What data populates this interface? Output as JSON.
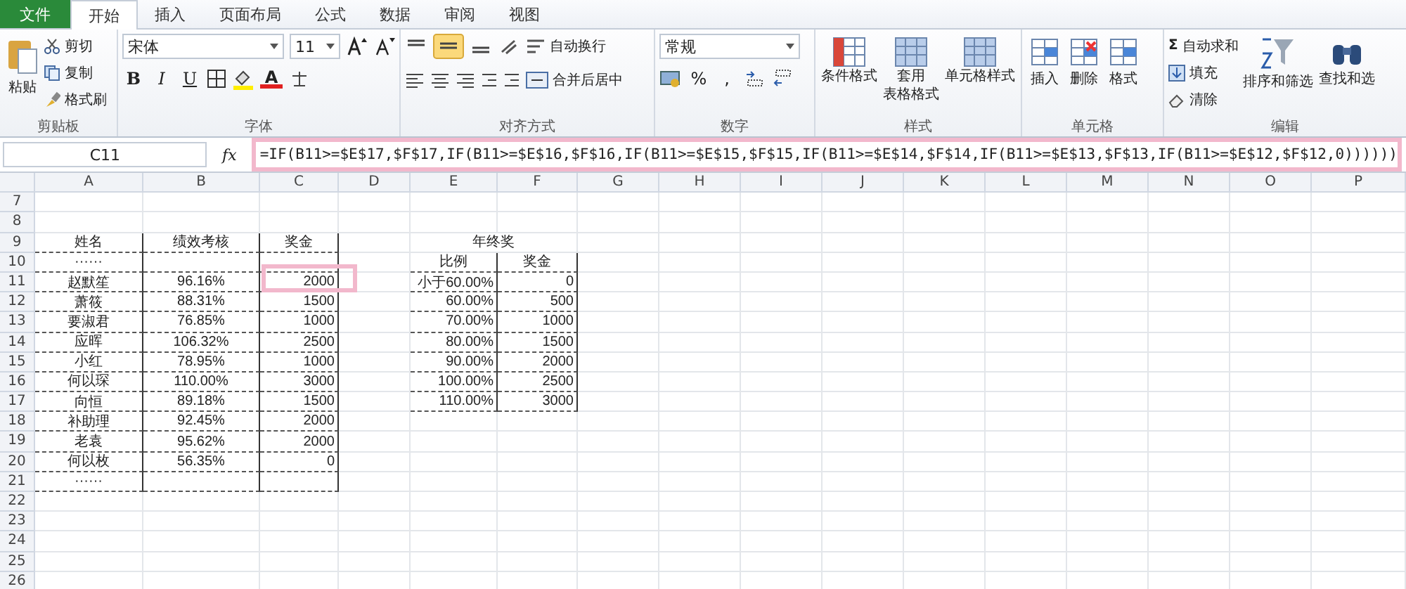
{
  "ribbon_tabs": [
    {
      "label": "文件",
      "kind": "file",
      "selected": false
    },
    {
      "label": "开始",
      "kind": "tab",
      "selected": true
    },
    {
      "label": "插入",
      "kind": "tab",
      "selected": false
    },
    {
      "label": "页面布局",
      "kind": "tab",
      "selected": false
    },
    {
      "label": "公式",
      "kind": "tab",
      "selected": false
    },
    {
      "label": "数据",
      "kind": "tab",
      "selected": false
    },
    {
      "label": "审阅",
      "kind": "tab",
      "selected": false
    },
    {
      "label": "视图",
      "kind": "tab",
      "selected": false
    }
  ],
  "ribbon": {
    "clipboard": {
      "label": "剪贴板",
      "paste": "粘贴",
      "cut": "剪切",
      "copy": "复制",
      "format_painter": "格式刷"
    },
    "font": {
      "label": "字体",
      "font_name": "宋体",
      "font_size": "11",
      "bold": "B",
      "italic": "I",
      "underline": "U",
      "font_color": "A"
    },
    "alignment": {
      "label": "对齐方式",
      "wrap_text": "自动换行",
      "merge_center": "合并后居中"
    },
    "number": {
      "label": "数字",
      "format": "常规",
      "percent": "%",
      "comma": ","
    },
    "styles": {
      "label": "样式",
      "buttons": [
        {
          "lines": [
            "条件格式"
          ]
        },
        {
          "lines": [
            "套用",
            "表格格式"
          ]
        },
        {
          "lines": [
            "单元格样式"
          ]
        }
      ]
    },
    "cells": {
      "label": "单元格",
      "buttons": [
        "插入",
        "删除",
        "格式"
      ]
    },
    "editing": {
      "label": "编辑",
      "sigma": "Σ",
      "autosum": "自动求和",
      "fill": "填充",
      "clear": "清除",
      "sort_filter": "排序和筛选",
      "find_select": "查找和选"
    }
  },
  "name_box": "C11",
  "fx": "fx",
  "formula": "=IF(B11>=$E$17,$F$17,IF(B11>=$E$16,$F$16,IF(B11>=$E$15,$F$15,IF(B11>=$E$14,$F$14,IF(B11>=$E$13,$F$13,IF(B11>=$E$12,$F$12,0))))))",
  "columns": [
    "A",
    "B",
    "C",
    "D",
    "E",
    "F",
    "G",
    "H",
    "I",
    "J",
    "K",
    "L",
    "M",
    "N",
    "O",
    "P"
  ],
  "rows": [
    {
      "number": "7",
      "cells": []
    },
    {
      "number": "8",
      "cells": []
    },
    {
      "number": "9",
      "cells": [
        {
          "text": "姓名",
          "boxed": true,
          "kind": "centered"
        },
        {
          "text": "绩效考核",
          "boxed": true,
          "kind": "centered"
        },
        {
          "text": "奖金",
          "boxed": true,
          "kind": "centered"
        },
        null,
        {
          "text": "年终奖",
          "merged": true,
          "kind": "centered"
        }
      ]
    },
    {
      "number": "10",
      "cells": [
        {
          "text": "······",
          "boxed": true,
          "kind": "centered"
        },
        {
          "boxed": true
        },
        {
          "boxed": true
        },
        null,
        {
          "text": "比例",
          "boxed": true,
          "kind": "centered"
        },
        {
          "text": "奖金",
          "boxed": true,
          "kind": "centered"
        }
      ]
    },
    {
      "number": "11",
      "cells": [
        {
          "text": "赵默笙",
          "boxed": true,
          "kind": "centered"
        },
        {
          "text": "96.16%",
          "boxed": true,
          "kind": "centered"
        },
        {
          "text": "2000",
          "boxed": true,
          "kind": "numeric"
        },
        null,
        {
          "text": "小于60.00%",
          "boxed": true,
          "kind": "numeric"
        },
        {
          "text": "0",
          "boxed": true,
          "kind": "numeric"
        }
      ]
    },
    {
      "number": "12",
      "cells": [
        {
          "text": "萧筱",
          "boxed": true,
          "kind": "centered"
        },
        {
          "text": "88.31%",
          "boxed": true,
          "kind": "centered"
        },
        {
          "text": "1500",
          "boxed": true,
          "kind": "numeric"
        },
        null,
        {
          "text": "60.00%",
          "boxed": true,
          "kind": "numeric"
        },
        {
          "text": "500",
          "boxed": true,
          "kind": "numeric"
        }
      ]
    },
    {
      "number": "13",
      "cells": [
        {
          "text": "要淑君",
          "boxed": true,
          "kind": "centered"
        },
        {
          "text": "76.85%",
          "boxed": true,
          "kind": "centered"
        },
        {
          "text": "1000",
          "boxed": true,
          "kind": "numeric"
        },
        null,
        {
          "text": "70.00%",
          "boxed": true,
          "kind": "numeric"
        },
        {
          "text": "1000",
          "boxed": true,
          "kind": "numeric"
        }
      ]
    },
    {
      "number": "14",
      "cells": [
        {
          "text": "应晖",
          "boxed": true,
          "kind": "centered"
        },
        {
          "text": "106.32%",
          "boxed": true,
          "kind": "centered"
        },
        {
          "text": "2500",
          "boxed": true,
          "kind": "numeric"
        },
        null,
        {
          "text": "80.00%",
          "boxed": true,
          "kind": "numeric"
        },
        {
          "text": "1500",
          "boxed": true,
          "kind": "numeric"
        }
      ]
    },
    {
      "number": "15",
      "cells": [
        {
          "text": "小红",
          "boxed": true,
          "kind": "centered"
        },
        {
          "text": "78.95%",
          "boxed": true,
          "kind": "centered"
        },
        {
          "text": "1000",
          "boxed": true,
          "kind": "numeric"
        },
        null,
        {
          "text": "90.00%",
          "boxed": true,
          "kind": "numeric"
        },
        {
          "text": "2000",
          "boxed": true,
          "kind": "numeric"
        }
      ]
    },
    {
      "number": "16",
      "cells": [
        {
          "text": "何以琛",
          "boxed": true,
          "kind": "centered"
        },
        {
          "text": "110.00%",
          "boxed": true,
          "kind": "centered"
        },
        {
          "text": "3000",
          "boxed": true,
          "kind": "numeric"
        },
        null,
        {
          "text": "100.00%",
          "boxed": true,
          "kind": "numeric"
        },
        {
          "text": "2500",
          "boxed": true,
          "kind": "numeric"
        }
      ]
    },
    {
      "number": "17",
      "cells": [
        {
          "text": "向恒",
          "boxed": true,
          "kind": "centered"
        },
        {
          "text": "89.18%",
          "boxed": true,
          "kind": "centered"
        },
        {
          "text": "1500",
          "boxed": true,
          "kind": "numeric"
        },
        null,
        {
          "text": "110.00%",
          "boxed": true,
          "kind": "numeric"
        },
        {
          "text": "3000",
          "boxed": true,
          "kind": "numeric"
        }
      ]
    },
    {
      "number": "18",
      "cells": [
        {
          "text": "补助理",
          "boxed": true,
          "kind": "centered"
        },
        {
          "text": "92.45%",
          "boxed": true,
          "kind": "centered"
        },
        {
          "text": "2000",
          "boxed": true,
          "kind": "numeric"
        }
      ]
    },
    {
      "number": "19",
      "cells": [
        {
          "text": "老袁",
          "boxed": true,
          "kind": "centered"
        },
        {
          "text": "95.62%",
          "boxed": true,
          "kind": "centered"
        },
        {
          "text": "2000",
          "boxed": true,
          "kind": "numeric"
        }
      ]
    },
    {
      "number": "20",
      "cells": [
        {
          "text": "何以枚",
          "boxed": true,
          "kind": "centered"
        },
        {
          "text": "56.35%",
          "boxed": true,
          "kind": "centered"
        },
        {
          "text": "0",
          "boxed": true,
          "kind": "numeric"
        }
      ]
    },
    {
      "number": "21",
      "cells": [
        {
          "text": "······",
          "boxed": true,
          "kind": "centered"
        },
        {
          "boxed": true
        },
        {
          "boxed": true
        }
      ]
    },
    {
      "number": "22",
      "cells": []
    },
    {
      "number": "23",
      "cells": []
    },
    {
      "number": "24",
      "cells": []
    },
    {
      "number": "25",
      "cells": []
    },
    {
      "number": "26",
      "cells": []
    }
  ]
}
